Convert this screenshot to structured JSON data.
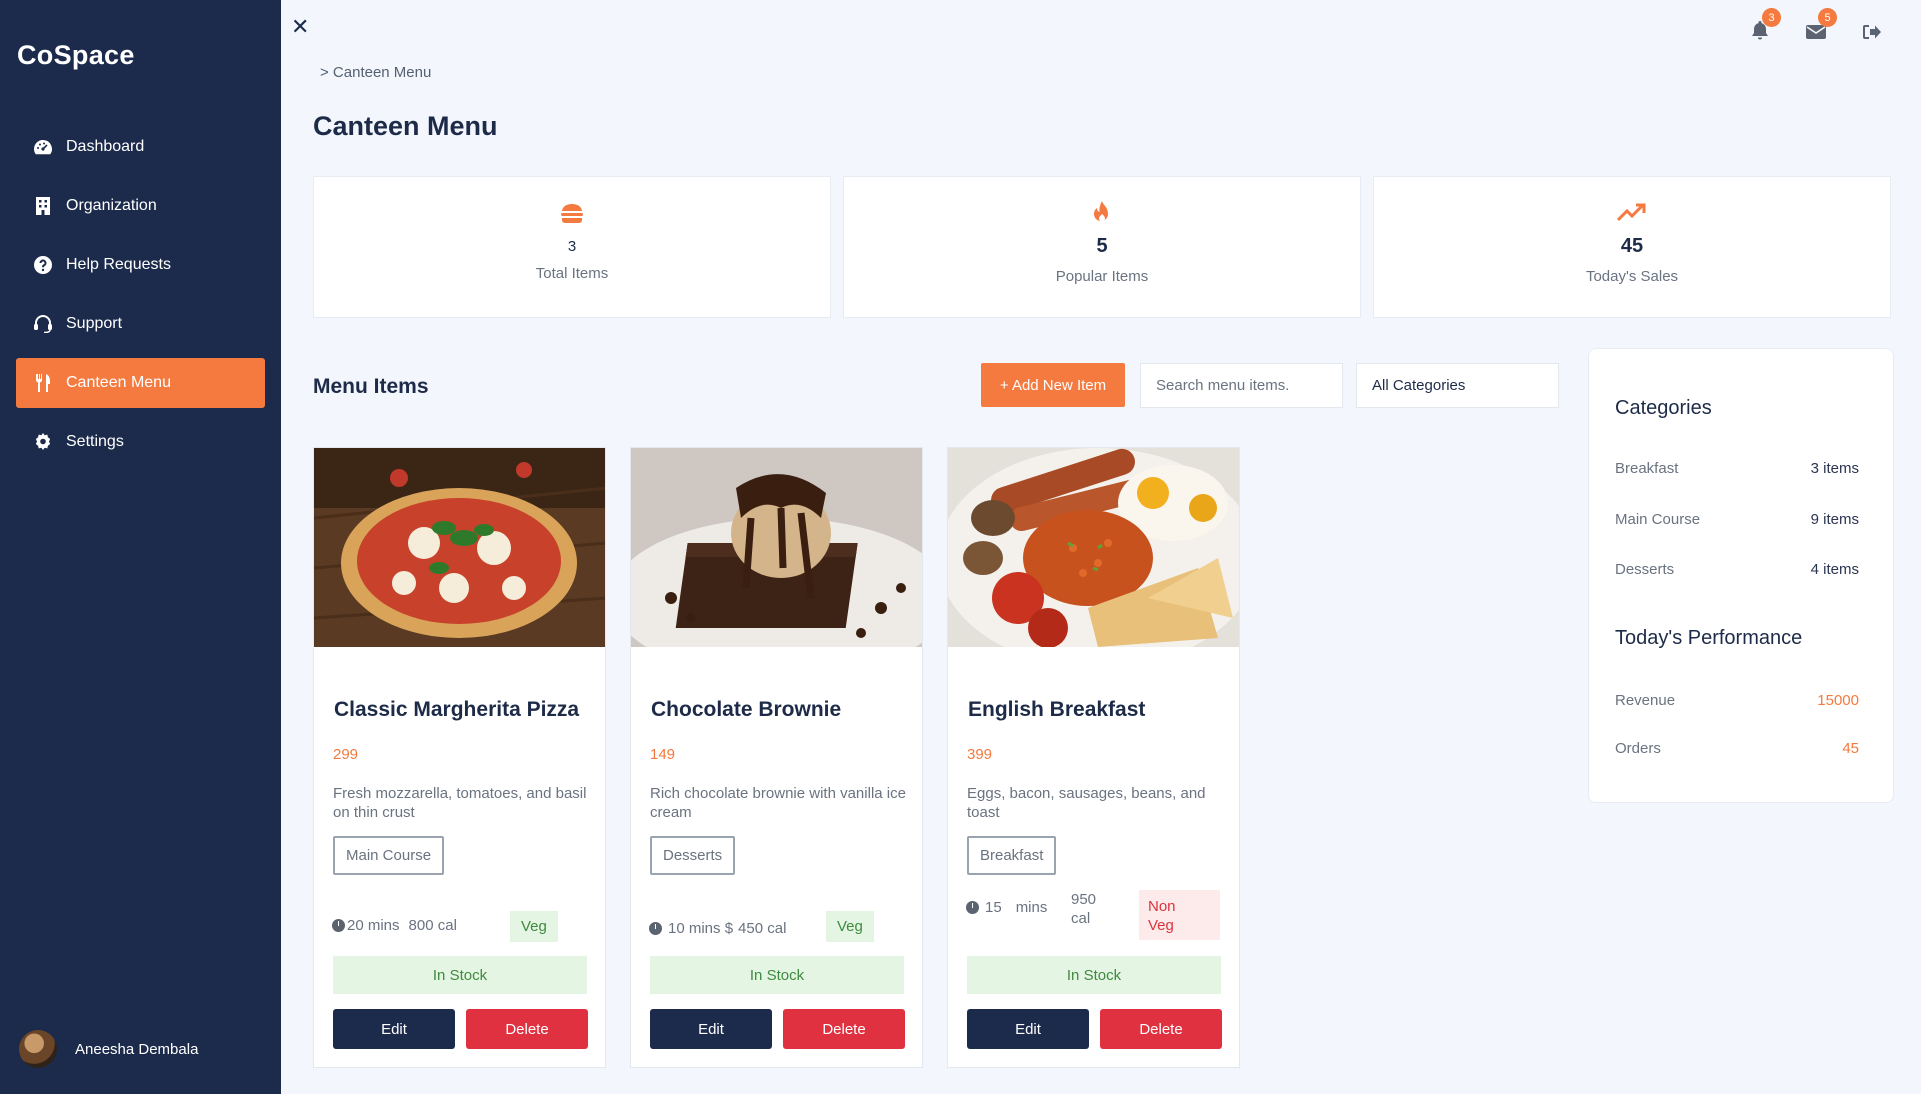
{
  "app": {
    "brand": "CoSpace"
  },
  "sidebar": {
    "items": [
      {
        "label": "Dashboard",
        "icon": "dashboard-icon"
      },
      {
        "label": "Organization",
        "icon": "building-icon"
      },
      {
        "label": "Help Requests",
        "icon": "question-icon"
      },
      {
        "label": "Support",
        "icon": "headset-icon"
      },
      {
        "label": "Canteen Menu",
        "icon": "utensils-icon",
        "active": true
      },
      {
        "label": "Settings",
        "icon": "gear-icon"
      }
    ],
    "user": {
      "name": "Aneesha Dembala"
    }
  },
  "topbar": {
    "notifications_count": "3",
    "messages_count": "5"
  },
  "breadcrumb": "> Canteen Menu",
  "page_title": "Canteen Menu",
  "stats": [
    {
      "value": "3",
      "label": "Total Items",
      "icon": "burger-icon"
    },
    {
      "value": "5",
      "label": "Popular Items",
      "icon": "fire-icon"
    },
    {
      "value": "45",
      "label": "Today's Sales",
      "icon": "trend-up-icon"
    }
  ],
  "menu": {
    "title": "Menu Items",
    "add_label": "+ Add New Item",
    "search_placeholder": "Search menu items.",
    "category_selected": "All Categories"
  },
  "items": [
    {
      "name": "Classic Margherita Pizza",
      "price": "299",
      "description": "Fresh mozzarella, tomatoes, and basil on thin crust",
      "category": "Main Course",
      "time": "20 mins",
      "calories": "800 cal",
      "diet": "Veg",
      "stock": "In Stock",
      "edit_label": "Edit",
      "delete_label": "Delete"
    },
    {
      "name": "Chocolate Brownie",
      "price": "149",
      "description": "Rich chocolate brownie with vanilla ice cream",
      "category": "Desserts",
      "time": "10 mins $",
      "calories": "450 cal",
      "diet": "Veg",
      "stock": "In Stock",
      "edit_label": "Edit",
      "delete_label": "Delete"
    },
    {
      "name": "English Breakfast",
      "price": "399",
      "description": "Eggs, bacon, sausages, beans, and toast",
      "category": "Breakfast",
      "time_num": "15",
      "time_unit": "mins",
      "cal_num": "950",
      "cal_unit": "cal",
      "diet_line1": "Non",
      "diet_line2": "Veg",
      "stock": "In Stock",
      "edit_label": "Edit",
      "delete_label": "Delete"
    }
  ],
  "categories_panel": {
    "title": "Categories",
    "rows": [
      {
        "name": "Breakfast",
        "count": "3 items"
      },
      {
        "name": "Main Course",
        "count": "9 items"
      },
      {
        "name": "Desserts",
        "count": "4 items"
      }
    ]
  },
  "performance": {
    "title": "Today's Performance",
    "rows": [
      {
        "name": "Revenue",
        "value": "15000"
      },
      {
        "name": "Orders",
        "value": "45"
      }
    ]
  },
  "colors": {
    "sidebar_bg": "#1c2b4c",
    "accent": "#f47a3f",
    "danger": "#e03140",
    "success_bg": "#e5f5e4",
    "page_bg": "#f3f7fd"
  }
}
